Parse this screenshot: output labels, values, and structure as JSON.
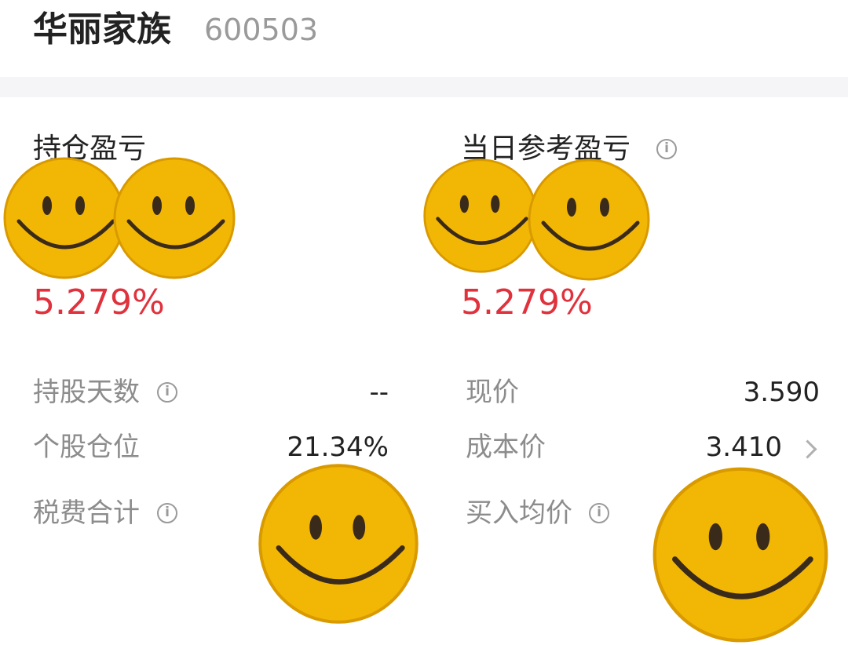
{
  "header": {
    "stock_name": "华丽家族",
    "stock_code": "600503"
  },
  "left": {
    "title": "持仓盈亏",
    "percent": "5.279%"
  },
  "right": {
    "title": "当日参考盈亏",
    "percent": "5.279%"
  },
  "details": {
    "holding_days": {
      "label": "持股天数",
      "value": "--"
    },
    "position_ratio": {
      "label": "个股仓位",
      "value": "21.34%"
    },
    "tax_total": {
      "label": "税费合计"
    },
    "current_price": {
      "label": "现价",
      "value": "3.590"
    },
    "cost_price": {
      "label": "成本价",
      "value": "3.410"
    },
    "avg_buy_price": {
      "label": "买入均价"
    }
  },
  "info_icon_glyph": "i",
  "colors": {
    "profit_red": "#e0323d",
    "label_gray": "#8c8c8c",
    "smiley_yellow": "#f2b705"
  }
}
